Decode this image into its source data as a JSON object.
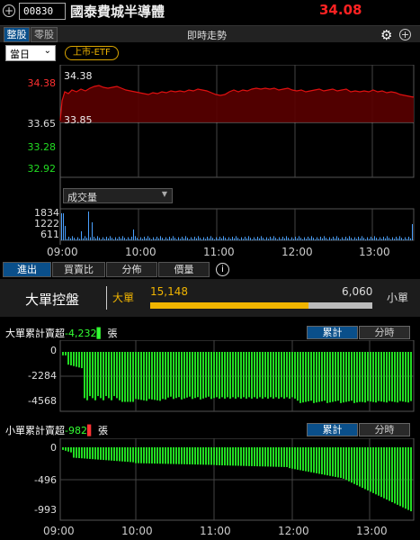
{
  "header": {
    "stock_code": "00830",
    "stock_name": "國泰費城半導體",
    "price": "34.08"
  },
  "tabs": {
    "whole": "整股",
    "odd": "零股",
    "realtime_title": "即時走勢"
  },
  "toolbar": {
    "period": "當日",
    "etf_badge": "上市-ETF"
  },
  "main_chart": {
    "price_ticks": [
      "34.38",
      "33.65",
      "33.28",
      "32.92"
    ],
    "inner_high": "34.38",
    "inner_low": "33.85",
    "volume_select": "成交量",
    "volume_ticks": [
      "1834",
      "1222",
      "611"
    ],
    "time_labels": [
      "09:00",
      "10:00",
      "11:00",
      "12:00",
      "13:00"
    ],
    "colors": {
      "price_line": "#e01010",
      "up": "#ff3030",
      "down": "#22dd22",
      "volume": "#4aa0ff"
    }
  },
  "bottom_tabs": [
    "進出",
    "買賣比",
    "分佈",
    "價量"
  ],
  "control": {
    "title": "大單控盤",
    "big_label": "大單",
    "big_value": "15,148",
    "small_value": "6,060",
    "small_label": "小單",
    "big_fraction": 0.714
  },
  "big_cum": {
    "title": "大單累計賣超",
    "value": "-4,232",
    "unit": "張",
    "toggle_cum": "累計",
    "toggle_time": "分時",
    "ticks": [
      "0",
      "-2284",
      "-4568"
    ]
  },
  "small_cum": {
    "title": "小單累計賣超",
    "value": "-982",
    "unit": "張",
    "toggle_cum": "累計",
    "toggle_time": "分時",
    "ticks": [
      "0",
      "-496",
      "-993"
    ]
  },
  "bottom_time_labels": [
    "09:00",
    "10:00",
    "11:00",
    "12:00",
    "13:00"
  ]
}
